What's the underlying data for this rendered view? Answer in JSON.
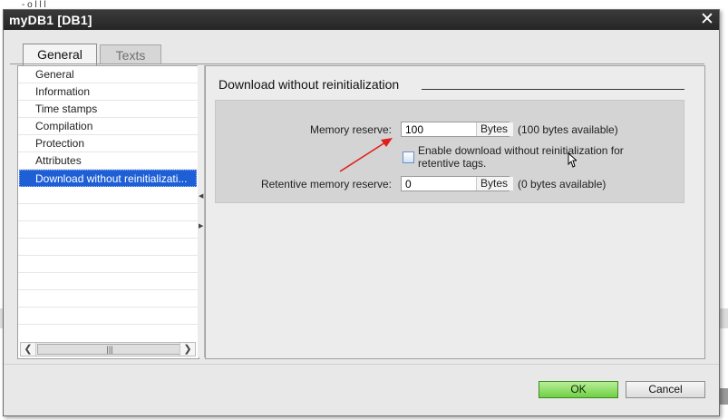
{
  "window": {
    "title": "myDB1 [DB1]"
  },
  "tabs": [
    {
      "label": "General",
      "active": true
    },
    {
      "label": "Texts",
      "active": false
    }
  ],
  "nav": {
    "items": [
      {
        "label": "General"
      },
      {
        "label": "Information"
      },
      {
        "label": "Time stamps"
      },
      {
        "label": "Compilation"
      },
      {
        "label": "Protection"
      },
      {
        "label": "Attributes"
      },
      {
        "label": "Download without reinitializati..."
      }
    ],
    "selected_index": 6
  },
  "section": {
    "title": "Download without reinitialization",
    "memory_reserve": {
      "label": "Memory reserve:",
      "value": "100",
      "unit": "Bytes",
      "available": "(100 bytes available)"
    },
    "checkbox": {
      "label_line1": "Enable download without reinitialization for",
      "label_line2": "retentive tags.",
      "checked": false
    },
    "retentive_reserve": {
      "label": "Retentive memory reserve:",
      "value": "0",
      "unit": "Bytes",
      "available": "(0 bytes available)"
    }
  },
  "buttons": {
    "ok": "OK",
    "cancel": "Cancel"
  },
  "colors": {
    "ok_green": "#6fcf44",
    "selection_blue": "#1f5fd6",
    "annotation_red": "#e0201b"
  }
}
